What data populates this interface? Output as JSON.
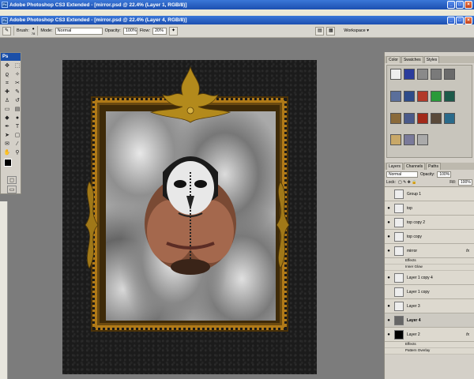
{
  "title_main": "Adobe Photoshop CS3 Extended - [mirror.psd @ 22.4% (Layer 1, RGB/8)]",
  "title_doc": "Adobe Photoshop CS3 Extended - [mirror.psd @ 22.4% (Layer 4, RGB/8)]",
  "options": {
    "brush_label": "Brush:",
    "brush_size": "78",
    "mode_label": "Mode:",
    "mode_value": "Normal",
    "opacity_label": "Opacity:",
    "opacity_value": "100%",
    "flow_label": "Flow:",
    "flow_value": "20%",
    "workspace_label": "Workspace"
  },
  "toolbox_title": "Ps",
  "colors": {
    "foreground": "#000000",
    "background": "#ffffff"
  },
  "styles_panel": {
    "tabs": [
      "Color",
      "Swatches",
      "Styles"
    ],
    "active_tab": "Styles"
  },
  "layers_panel": {
    "tabs": [
      "Layers",
      "Channels",
      "Paths"
    ],
    "blend_mode": "Normal",
    "opacity_label": "Opacity:",
    "opacity_value": "100%",
    "lock_label": "Lock:",
    "fill_label": "Fill:",
    "fill_value": "100%",
    "layers": [
      {
        "name": "Group 1",
        "visible": false
      },
      {
        "name": "top",
        "visible": true
      },
      {
        "name": "top copy 2",
        "visible": true
      },
      {
        "name": "top copy",
        "visible": true
      },
      {
        "name": "mirror",
        "visible": true,
        "fx": "fx",
        "effects": [
          "Effects",
          "Inner Glow"
        ]
      },
      {
        "name": "Layer 1 copy 4",
        "visible": true
      },
      {
        "name": "Layer 1 copy",
        "visible": false
      },
      {
        "name": "Layer 3",
        "visible": true
      },
      {
        "name": "Layer 4",
        "visible": true,
        "selected": true
      },
      {
        "name": "Layer 2",
        "visible": true,
        "fx": "fx",
        "effects": [
          "Effects",
          "Pattern Overlay"
        ]
      }
    ]
  }
}
